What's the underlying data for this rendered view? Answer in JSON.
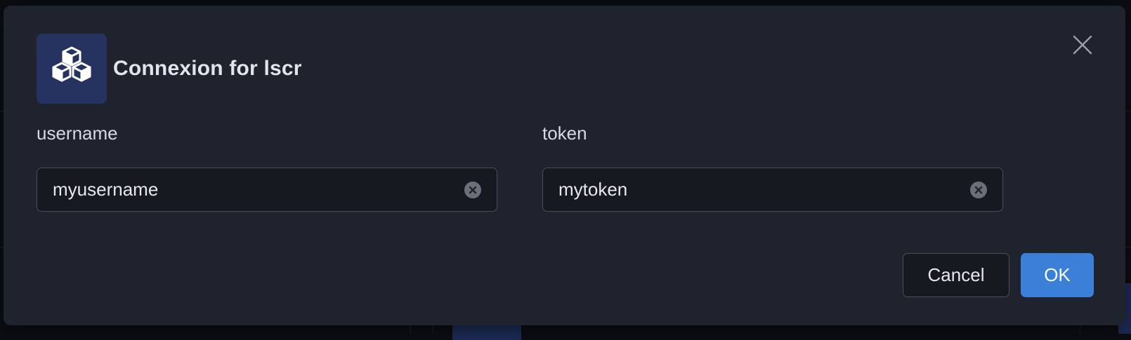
{
  "dialog": {
    "title": "Connexion for lscr",
    "brand_icon": "stacked-cubes-icon",
    "close_icon": "close-icon"
  },
  "fields": [
    {
      "label": "username",
      "value": "myusername",
      "clear_icon": "clear-icon"
    },
    {
      "label": "token",
      "value": "mytoken",
      "clear_icon": "clear-icon"
    }
  ],
  "actions": {
    "cancel_label": "Cancel",
    "ok_label": "OK"
  },
  "colors": {
    "accent": "#3b7fd9",
    "dialog_bg": "#1f232e",
    "brand_tile": "#26325f"
  }
}
